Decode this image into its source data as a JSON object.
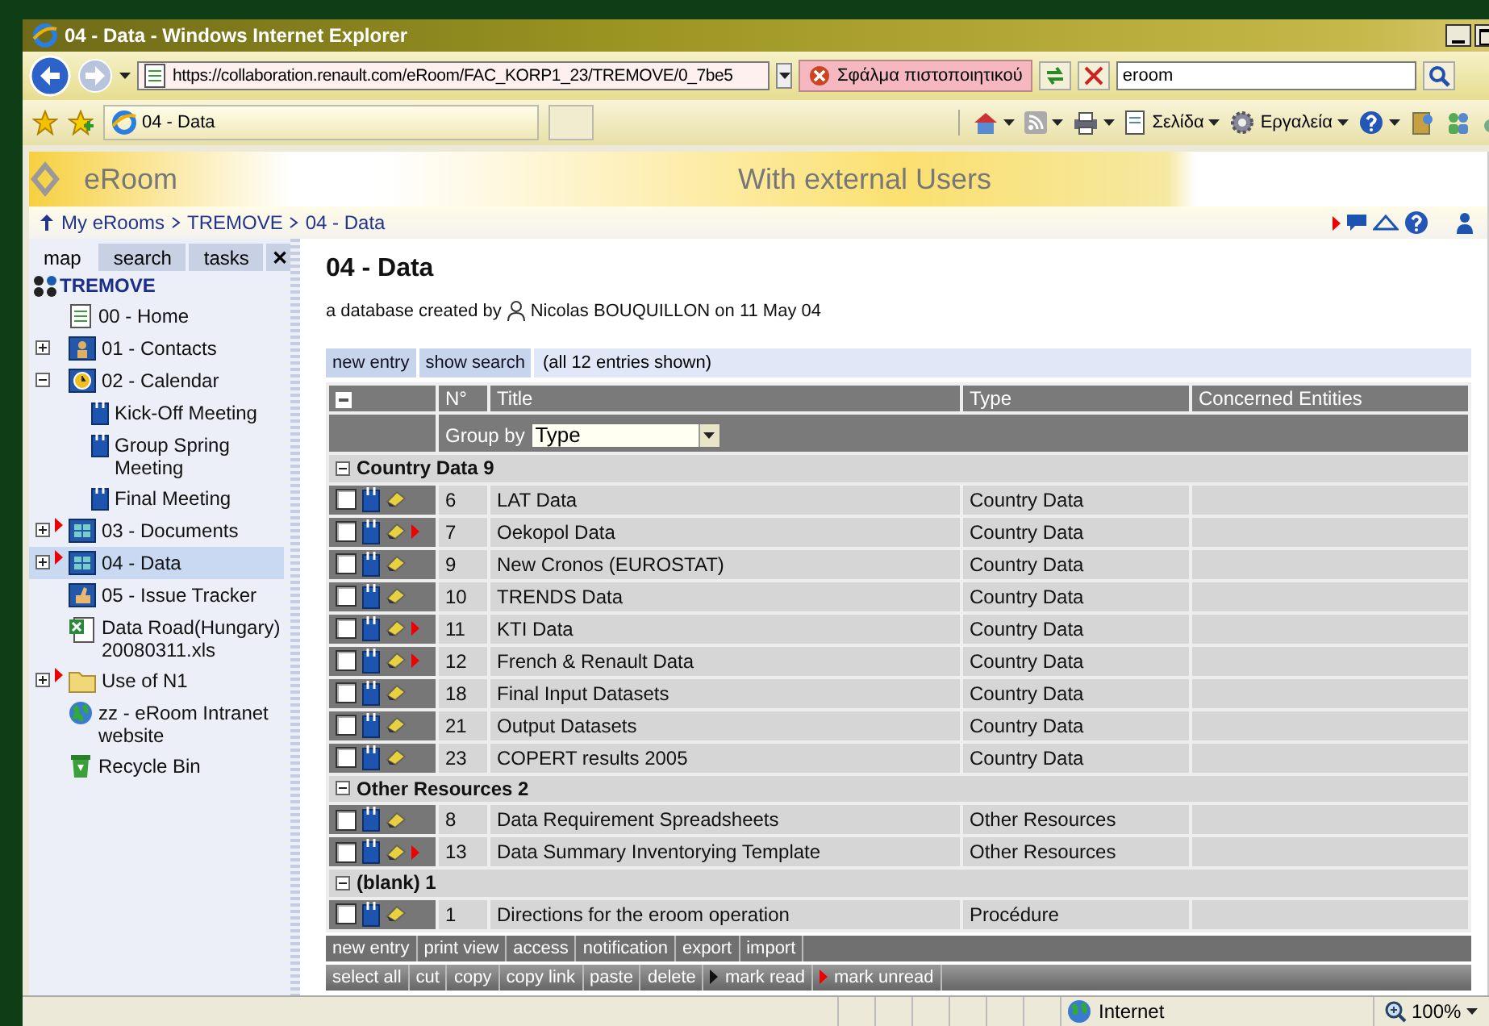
{
  "window": {
    "title": "04 - Data - Windows Internet Explorer"
  },
  "address_bar": {
    "url": "https://collaboration.renault.com/eRoom/FAC_KORP1_23/TREMOVE/0_7be5",
    "certificate_error": "Σφάλμα πιστοποιητικού"
  },
  "search_box": {
    "value": "eroom"
  },
  "tabs": [
    {
      "label": "04 - Data",
      "selected": true
    }
  ],
  "command_bar": [
    {
      "kind": "home"
    },
    {
      "kind": "feeds"
    },
    {
      "kind": "print"
    },
    {
      "kind": "page",
      "label": "Σελίδα"
    },
    {
      "kind": "tools",
      "label": "Εργαλεία"
    },
    {
      "kind": "help"
    },
    {
      "kind": "research"
    },
    {
      "kind": "messenger"
    },
    {
      "kind": "addon"
    }
  ],
  "banner": {
    "app": "eRoom",
    "subtitle": "With external Users"
  },
  "breadcrumb": [
    "My eRooms",
    "TREMOVE",
    "04 - Data"
  ],
  "sidebar": {
    "tabs": [
      {
        "label": "map",
        "selected": true
      },
      {
        "label": "search",
        "selected": false
      },
      {
        "label": "tasks",
        "selected": false
      }
    ],
    "close": "✕",
    "tree": {
      "label": "TREMOVE",
      "children": [
        {
          "label": "00 - Home",
          "kind": "page",
          "selected": false,
          "unread": false
        },
        {
          "label": "01 - Contacts",
          "kind": "contacts",
          "selected": false,
          "unread": false,
          "expanded": false
        },
        {
          "label": "02 - Calendar",
          "kind": "calendar",
          "selected": false,
          "unread": false,
          "expanded": true,
          "children": [
            {
              "label": "Kick-Off Meeting",
              "kind": "event",
              "selected": false,
              "unread": false
            },
            {
              "label": "Group Spring Meeting",
              "kind": "event",
              "selected": false,
              "unread": false
            },
            {
              "label": "Final Meeting",
              "kind": "event",
              "selected": false,
              "unread": false
            }
          ]
        },
        {
          "label": "03 - Documents",
          "kind": "database",
          "selected": false,
          "unread": true,
          "expanded": false
        },
        {
          "label": "04 - Data",
          "kind": "database",
          "selected": true,
          "unread": true,
          "expanded": false
        },
        {
          "label": "05 - Issue Tracker",
          "kind": "tracker",
          "selected": false,
          "unread": false
        },
        {
          "label": "Data Road(Hungary) 20080311.xls",
          "kind": "excel",
          "selected": false,
          "unread": false
        },
        {
          "label": "Use of N1",
          "kind": "folder",
          "selected": false,
          "unread": true,
          "expanded": false
        },
        {
          "label": "zz - eRoom Intranet website",
          "kind": "link",
          "selected": false,
          "unread": false
        },
        {
          "label": "Recycle Bin",
          "kind": "recycle",
          "selected": false,
          "unread": false
        }
      ]
    }
  },
  "page": {
    "title": "04 - Data",
    "byline": "a database created by",
    "author": "Nicolas BOUQUILLON on 11 May 04"
  },
  "top_actions": [
    "new entry",
    "show search"
  ],
  "entry_count": "(all 12 entries shown)",
  "table": {
    "columns": [
      "N°",
      "Title",
      "Type",
      "Concerned Entities"
    ],
    "group_by": {
      "label": "Group by",
      "value": "Type"
    },
    "groups": [
      {
        "label": "Country Data 9",
        "expanded": true,
        "rows": [
          {
            "number": "6",
            "title": "LAT Data",
            "type": "Country Data",
            "checked": false,
            "unread": false
          },
          {
            "number": "7",
            "title": "Oekopol Data",
            "type": "Country Data",
            "checked": false,
            "unread": true
          },
          {
            "number": "9",
            "title": "New Cronos (EUROSTAT)",
            "type": "Country Data",
            "checked": false,
            "unread": false
          },
          {
            "number": "10",
            "title": "TRENDS Data",
            "type": "Country Data",
            "checked": false,
            "unread": false
          },
          {
            "number": "11",
            "title": "KTI Data",
            "type": "Country Data",
            "checked": false,
            "unread": true
          },
          {
            "number": "12",
            "title": "French & Renault Data",
            "type": "Country Data",
            "checked": false,
            "unread": true
          },
          {
            "number": "18",
            "title": "Final Input Datasets",
            "type": "Country Data",
            "checked": false,
            "unread": false
          },
          {
            "number": "21",
            "title": "Output Datasets",
            "type": "Country Data",
            "checked": false,
            "unread": false
          },
          {
            "number": "23",
            "title": "COPERT results 2005",
            "type": "Country Data",
            "checked": false,
            "unread": false
          }
        ]
      },
      {
        "label": "Other Resources 2",
        "expanded": true,
        "rows": [
          {
            "number": "8",
            "title": "Data Requirement Spreadsheets",
            "type": "Other Resources",
            "checked": false,
            "unread": false
          },
          {
            "number": "13",
            "title": "Data Summary Inventorying Template",
            "type": "Other Resources",
            "checked": false,
            "unread": true
          }
        ]
      },
      {
        "label": "(blank) 1",
        "expanded": true,
        "rows": [
          {
            "number": "1",
            "title": "Directions for the eroom operation",
            "type": "Procédure",
            "checked": false,
            "unread": false
          }
        ]
      }
    ]
  },
  "bottom_actions": [
    "new entry",
    "print view",
    "access",
    "notification",
    "export",
    "import"
  ],
  "selection_actions": [
    {
      "label": "select all",
      "kind": "plain"
    },
    {
      "label": "cut",
      "kind": "plain"
    },
    {
      "label": "copy",
      "kind": "plain"
    },
    {
      "label": "copy link",
      "kind": "plain"
    },
    {
      "label": "paste",
      "kind": "plain"
    },
    {
      "label": "delete",
      "kind": "plain"
    },
    {
      "label": "mark read",
      "kind": "read"
    },
    {
      "label": "mark unread",
      "kind": "unread"
    }
  ],
  "status_bar": {
    "zone": "Internet",
    "zoom": "100%"
  }
}
